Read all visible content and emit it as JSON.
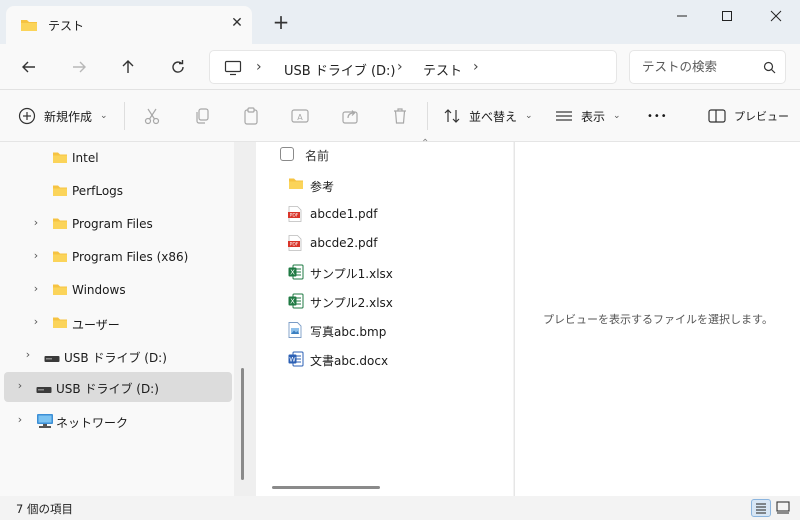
{
  "window": {
    "tab_title": "テスト",
    "new_tab_symbol": "+",
    "close_tab_symbol": "✕"
  },
  "address": {
    "crumbs": [
      "USB ドライブ (D:)",
      "テスト"
    ]
  },
  "search": {
    "placeholder": "テストの検索"
  },
  "toolbar": {
    "new_label": "新規作成",
    "sort_label": "並べ替え",
    "view_label": "表示",
    "more_symbol": "•••",
    "preview_label": "プレビュー"
  },
  "nav": {
    "items": [
      {
        "label": "Intel",
        "icon": "folder-icon",
        "expandable": false
      },
      {
        "label": "PerfLogs",
        "icon": "folder-icon",
        "expandable": false
      },
      {
        "label": "Program Files",
        "icon": "folder-icon",
        "expandable": true
      },
      {
        "label": "Program Files (x86)",
        "icon": "folder-icon",
        "expandable": true
      },
      {
        "label": "Windows",
        "icon": "folder-icon",
        "expandable": true
      },
      {
        "label": "ユーザー",
        "icon": "folder-icon",
        "expandable": true
      },
      {
        "label": "USB ドライブ (D:)",
        "icon": "drive-icon",
        "expandable": true
      },
      {
        "label": "USB ドライブ (D:)",
        "icon": "drive-icon",
        "expandable": true,
        "selected": true
      },
      {
        "label": "ネットワーク",
        "icon": "network-icon",
        "expandable": true
      }
    ]
  },
  "files": {
    "header": "名前",
    "items": [
      {
        "name": "参考",
        "icon": "folder-icon"
      },
      {
        "name": "abcde1.pdf",
        "icon": "pdf-icon"
      },
      {
        "name": "abcde2.pdf",
        "icon": "pdf-icon"
      },
      {
        "name": "サンプル1.xlsx",
        "icon": "excel-icon"
      },
      {
        "name": "サンプル2.xlsx",
        "icon": "excel-icon"
      },
      {
        "name": "写真abc.bmp",
        "icon": "image-icon"
      },
      {
        "name": "文書abc.docx",
        "icon": "word-icon"
      }
    ]
  },
  "preview": {
    "message": "プレビューを表示するファイルを選択します。"
  },
  "status": {
    "item_count": "7 個の項目"
  },
  "colors": {
    "folder": "#f6c342",
    "pdf": "#d9352a",
    "excel": "#1f7a43",
    "word": "#2b5fb4",
    "accent": "#0067c0"
  }
}
